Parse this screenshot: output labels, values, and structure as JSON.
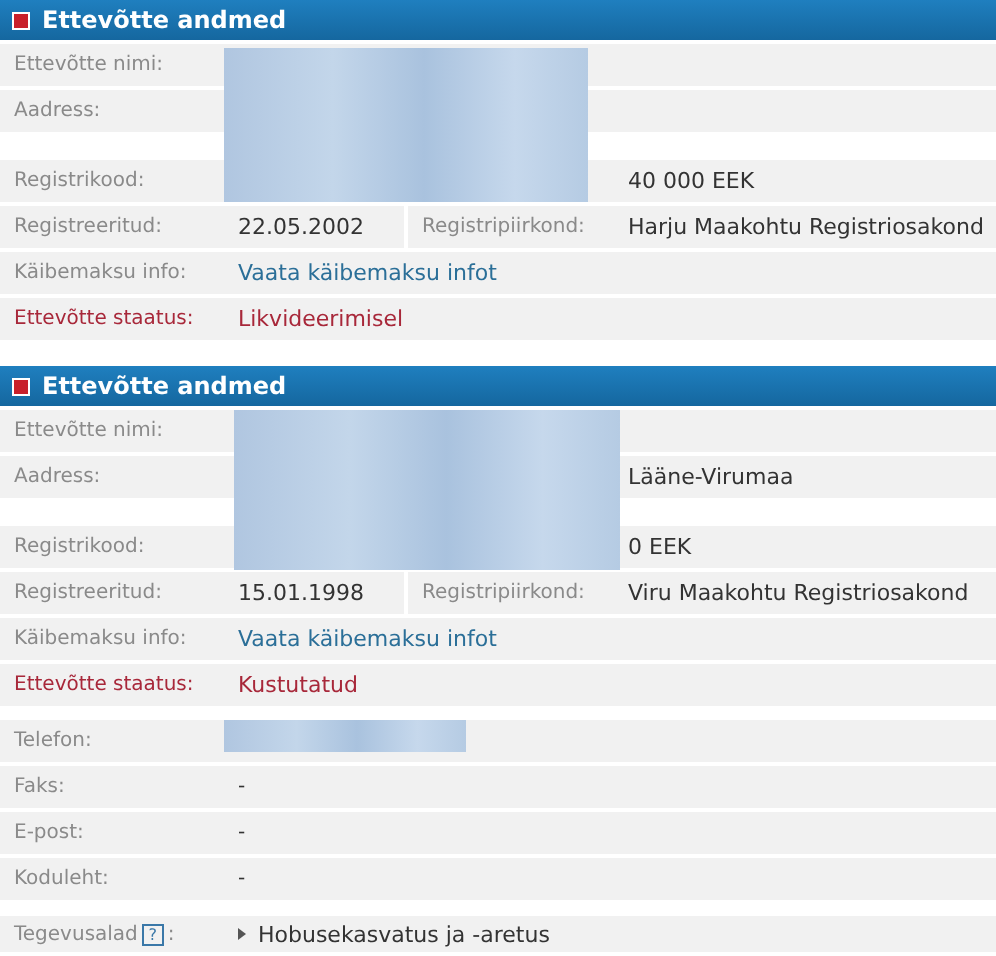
{
  "panels": [
    {
      "title": "Ettevõtte andmed",
      "redacted": true,
      "rows": [
        {
          "kind": "field",
          "label": "Ettevõtte nimi:"
        },
        {
          "kind": "field",
          "label": "Aadress:"
        },
        {
          "kind": "spacer"
        },
        {
          "kind": "field",
          "label": "Registrikood:",
          "value2": "40 000 EEK"
        },
        {
          "kind": "field",
          "label": "Registreeritud:",
          "value": "22.05.2002",
          "label2": "Registripiirkond:",
          "value2": "Harju Maakohtu Registriosakond"
        },
        {
          "kind": "link",
          "label": "Käibemaksu info:",
          "value": "Vaata käibemaksu infot"
        },
        {
          "kind": "status",
          "label": "Ettevõtte staatus:",
          "value": "Likvideerimisel"
        }
      ]
    },
    {
      "title": "Ettevõtte andmed",
      "redacted": true,
      "rows": [
        {
          "kind": "field",
          "label": "Ettevõtte nimi:"
        },
        {
          "kind": "field",
          "label": "Aadress:",
          "value2": "Lääne-Virumaa"
        },
        {
          "kind": "spacer"
        },
        {
          "kind": "field",
          "label": "Registrikood:",
          "value2": "0 EEK"
        },
        {
          "kind": "field",
          "label": "Registreeritud:",
          "value": "15.01.1998",
          "label2": "Registripiirkond:",
          "value2": "Viru Maakohtu Registriosakond"
        },
        {
          "kind": "link",
          "label": "Käibemaksu info:",
          "value": "Vaata käibemaksu infot"
        },
        {
          "kind": "status",
          "label": "Ettevõtte staatus:",
          "value": "Kustutatud"
        }
      ]
    }
  ],
  "contacts": [
    {
      "label": "Telefon:",
      "redacted": true
    },
    {
      "label": "Faks:",
      "value": "-",
      "redacted": false
    },
    {
      "label": "E-post:",
      "value": "-",
      "redacted": false
    },
    {
      "label": "Koduleht:",
      "value": "-",
      "redacted": false
    }
  ],
  "activities": {
    "label": "Tegevusalad",
    "help": "?",
    "suffix": ":",
    "items": [
      "Hobusekasvatus ja -aretus"
    ]
  }
}
